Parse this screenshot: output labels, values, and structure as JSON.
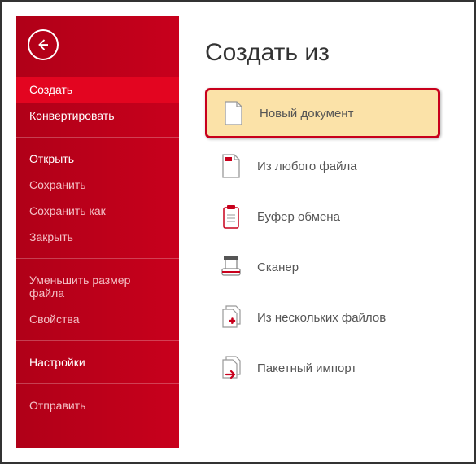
{
  "sidebar": {
    "items": [
      {
        "label": "Создать",
        "active": true,
        "strong": true
      },
      {
        "label": "Конвертировать",
        "strong": true
      },
      {
        "sep": true
      },
      {
        "label": "Открыть",
        "strong": true
      },
      {
        "label": "Сохранить"
      },
      {
        "label": "Сохранить как"
      },
      {
        "label": "Закрыть"
      },
      {
        "sep": true
      },
      {
        "label": "Уменьшить размер файла"
      },
      {
        "label": "Свойства"
      },
      {
        "sep": true
      },
      {
        "label": "Настройки",
        "strong": true
      },
      {
        "sep": true
      },
      {
        "label": "Отправить"
      }
    ]
  },
  "main": {
    "title": "Создать из",
    "options": [
      {
        "label": "Новый документ",
        "icon": "blank-document-icon",
        "highlight": true
      },
      {
        "label": "Из любого файла",
        "icon": "file-icon"
      },
      {
        "label": "Буфер обмена",
        "icon": "clipboard-icon"
      },
      {
        "label": "Сканер",
        "icon": "scanner-icon"
      },
      {
        "label": "Из нескольких файлов",
        "icon": "multi-file-icon"
      },
      {
        "label": "Пакетный импорт",
        "icon": "batch-import-icon"
      }
    ]
  }
}
